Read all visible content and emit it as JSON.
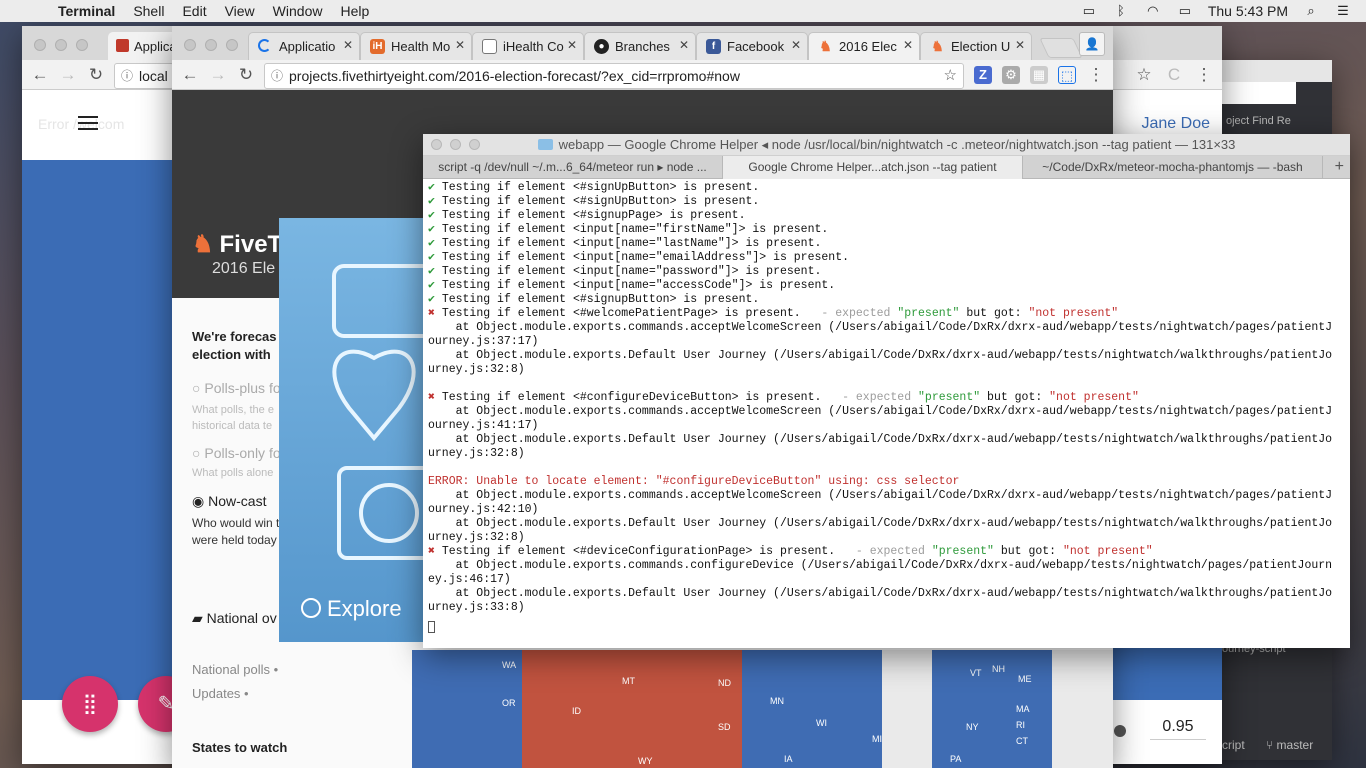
{
  "menubar": {
    "app": "Terminal",
    "items": [
      "Shell",
      "Edit",
      "View",
      "Window",
      "Help"
    ],
    "clock": "Thu 5:43 PM"
  },
  "back_window": {
    "tab_title": "Applicati",
    "url_fragment": "local",
    "error_text": "Error",
    "path_text": "/welcom",
    "user_name": "Jane Doe",
    "slider_value": "0.95"
  },
  "side_window": {
    "project_text": "oject Find Re",
    "script_text": "ourney-script",
    "branch_script": "cript",
    "branch": "master"
  },
  "chrome538": {
    "tabs": [
      {
        "title": "Applicatio",
        "fav": "spinner"
      },
      {
        "title": "Health Mo",
        "fav": "iH"
      },
      {
        "title": "iHealth Co",
        "fav": "doc"
      },
      {
        "title": "Branches",
        "fav": "github"
      },
      {
        "title": "Facebook",
        "fav": "f"
      },
      {
        "title": "2016 Elec",
        "fav": "fox"
      },
      {
        "title": "Election U",
        "fav": "fox"
      }
    ],
    "url": "projects.fivethirtyeight.com/2016-election-forecast/?ex_cid=rrpromo#now"
  },
  "page538": {
    "logo": "FiveT",
    "subtitle": "2016 Ele",
    "intro": [
      "We're forecas",
      "election with"
    ],
    "options": [
      {
        "label": "Polls-plus fo",
        "desc": [
          "What polls, the e",
          "historical data te"
        ],
        "selected": false
      },
      {
        "label": "Polls-only fo",
        "desc": [
          "What polls alone"
        ],
        "selected": false
      },
      {
        "label": "Now-cast",
        "desc": [
          "Who would win t",
          "were held today"
        ],
        "selected": true
      }
    ],
    "national": "National ov",
    "links": [
      "National polls •",
      "Updates •"
    ],
    "states_to_watch": "States to watch",
    "ad_cta": "Explore",
    "map_states": [
      "WA",
      "MT",
      "ND",
      "OR",
      "ID",
      "SD",
      "WY",
      "MN",
      "WI",
      "MI",
      "IA",
      "NY",
      "PA",
      "VT",
      "NH",
      "ME",
      "MA",
      "RI",
      "CT"
    ]
  },
  "terminal": {
    "title": "webapp — Google Chrome Helper ◂ node /usr/local/bin/nightwatch -c .meteor/nightwatch.json --tag patient — 131×33",
    "tabs": [
      "script -q /dev/null ~/.m...6_64/meteor run ▸ node  ...",
      "Google Chrome Helper...atch.json --tag patient",
      "~/Code/DxRx/meteor-mocha-phantomjs — -bash"
    ],
    "lines": [
      {
        "type": "ok",
        "text": "Testing if element <#signUpButton> is present."
      },
      {
        "type": "ok",
        "text": "Testing if element <#signUpButton> is present."
      },
      {
        "type": "ok",
        "text": "Testing if element <#signupPage> is present."
      },
      {
        "type": "ok",
        "text": "Testing if element <input[name=\"firstName\"]> is present."
      },
      {
        "type": "ok",
        "text": "Testing if element <input[name=\"lastName\"]> is present."
      },
      {
        "type": "ok",
        "text": "Testing if element <input[name=\"emailAddress\"]> is present."
      },
      {
        "type": "ok",
        "text": "Testing if element <input[name=\"password\"]> is present."
      },
      {
        "type": "ok",
        "text": "Testing if element <input[name=\"accessCode\"]> is present."
      },
      {
        "type": "ok",
        "text": "Testing if element <#signupButton> is present."
      },
      {
        "type": "fail",
        "text": "Testing if element <#welcomePatientPage> is present.",
        "pad": "  ",
        "expected": "present",
        "got": "not present"
      },
      {
        "type": "plain",
        "text": "    at Object.module.exports.commands.acceptWelcomeScreen (/Users/abigail/Code/DxRx/dxrx-aud/webapp/tests/nightwatch/pages/patientJ"
      },
      {
        "type": "plain",
        "text": "ourney.js:37:17)"
      },
      {
        "type": "plain",
        "text": "    at Object.module.exports.Default User Journey (/Users/abigail/Code/DxRx/dxrx-aud/webapp/tests/nightwatch/walkthroughs/patientJo"
      },
      {
        "type": "plain",
        "text": "urney.js:32:8)"
      },
      {
        "type": "plain",
        "text": ""
      },
      {
        "type": "fail",
        "text": "Testing if element <#configureDeviceButton> is present.",
        "pad": "  ",
        "expected": "present",
        "got": "not present"
      },
      {
        "type": "plain",
        "text": "    at Object.module.exports.commands.acceptWelcomeScreen (/Users/abigail/Code/DxRx/dxrx-aud/webapp/tests/nightwatch/pages/patientJ"
      },
      {
        "type": "plain",
        "text": "ourney.js:41:17)"
      },
      {
        "type": "plain",
        "text": "    at Object.module.exports.Default User Journey (/Users/abigail/Code/DxRx/dxrx-aud/webapp/tests/nightwatch/walkthroughs/patientJo"
      },
      {
        "type": "plain",
        "text": "urney.js:32:8)"
      },
      {
        "type": "plain",
        "text": ""
      },
      {
        "type": "error",
        "text": "ERROR: Unable to locate element: \"#configureDeviceButton\" using: css selector"
      },
      {
        "type": "plain",
        "text": "    at Object.module.exports.commands.acceptWelcomeScreen (/Users/abigail/Code/DxRx/dxrx-aud/webapp/tests/nightwatch/pages/patientJ"
      },
      {
        "type": "plain",
        "text": "ourney.js:42:10)"
      },
      {
        "type": "plain",
        "text": "    at Object.module.exports.Default User Journey (/Users/abigail/Code/DxRx/dxrx-aud/webapp/tests/nightwatch/walkthroughs/patientJo"
      },
      {
        "type": "plain",
        "text": "urney.js:32:8)"
      },
      {
        "type": "fail",
        "text": "Testing if element <#deviceConfigurationPage> is present.",
        "pad": "  ",
        "expected": "present",
        "got": "not present"
      },
      {
        "type": "plain",
        "text": "    at Object.module.exports.commands.configureDevice (/Users/abigail/Code/DxRx/dxrx-aud/webapp/tests/nightwatch/pages/patientJourn"
      },
      {
        "type": "plain",
        "text": "ey.js:46:17)"
      },
      {
        "type": "plain",
        "text": "    at Object.module.exports.Default User Journey (/Users/abigail/Code/DxRx/dxrx-aud/webapp/tests/nightwatch/walkthroughs/patientJo"
      },
      {
        "type": "plain",
        "text": "urney.js:33:8)"
      }
    ],
    "expected_word": "expected",
    "got_word": "but got:"
  }
}
